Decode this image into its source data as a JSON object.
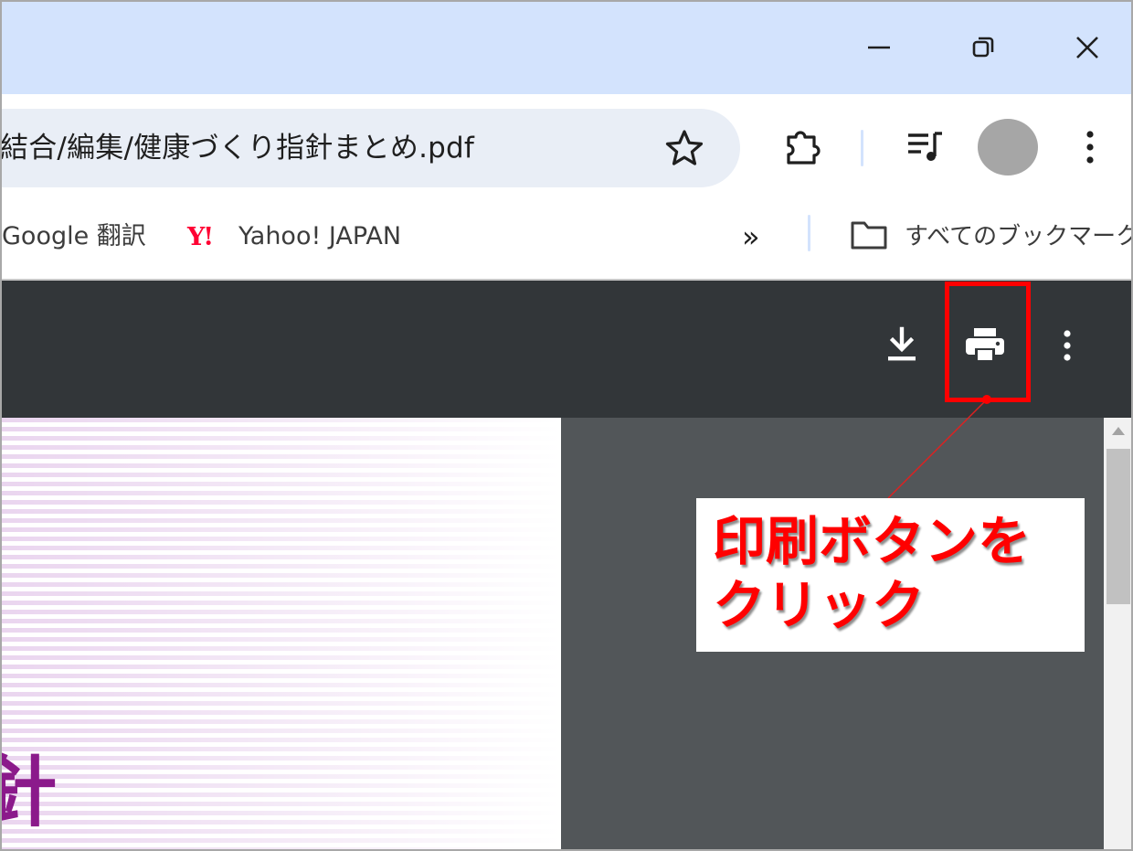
{
  "address_bar": {
    "url_text": "結合/編集/健康づくり指針まとめ.pdf"
  },
  "bookmarks": {
    "items": [
      {
        "label": "Google 翻訳"
      },
      {
        "logo": "Y!",
        "label": "Yahoo! JAPAN"
      }
    ],
    "more_label": "»",
    "all_bookmarks_label": "すべてのブックマーク"
  },
  "pdf_toolbar": {
    "icons": [
      "download-icon",
      "print-icon",
      "more-vert-icon"
    ]
  },
  "page": {
    "partial_title_glyph": "針"
  },
  "annotation": {
    "text": "印刷ボタンを\nクリック",
    "color": "#ff0000"
  },
  "colors": {
    "titlebar": "#d3e3fd",
    "omnibox": "#e9eef6",
    "pdf_toolbar": "#323639",
    "viewer_background": "#525659"
  }
}
